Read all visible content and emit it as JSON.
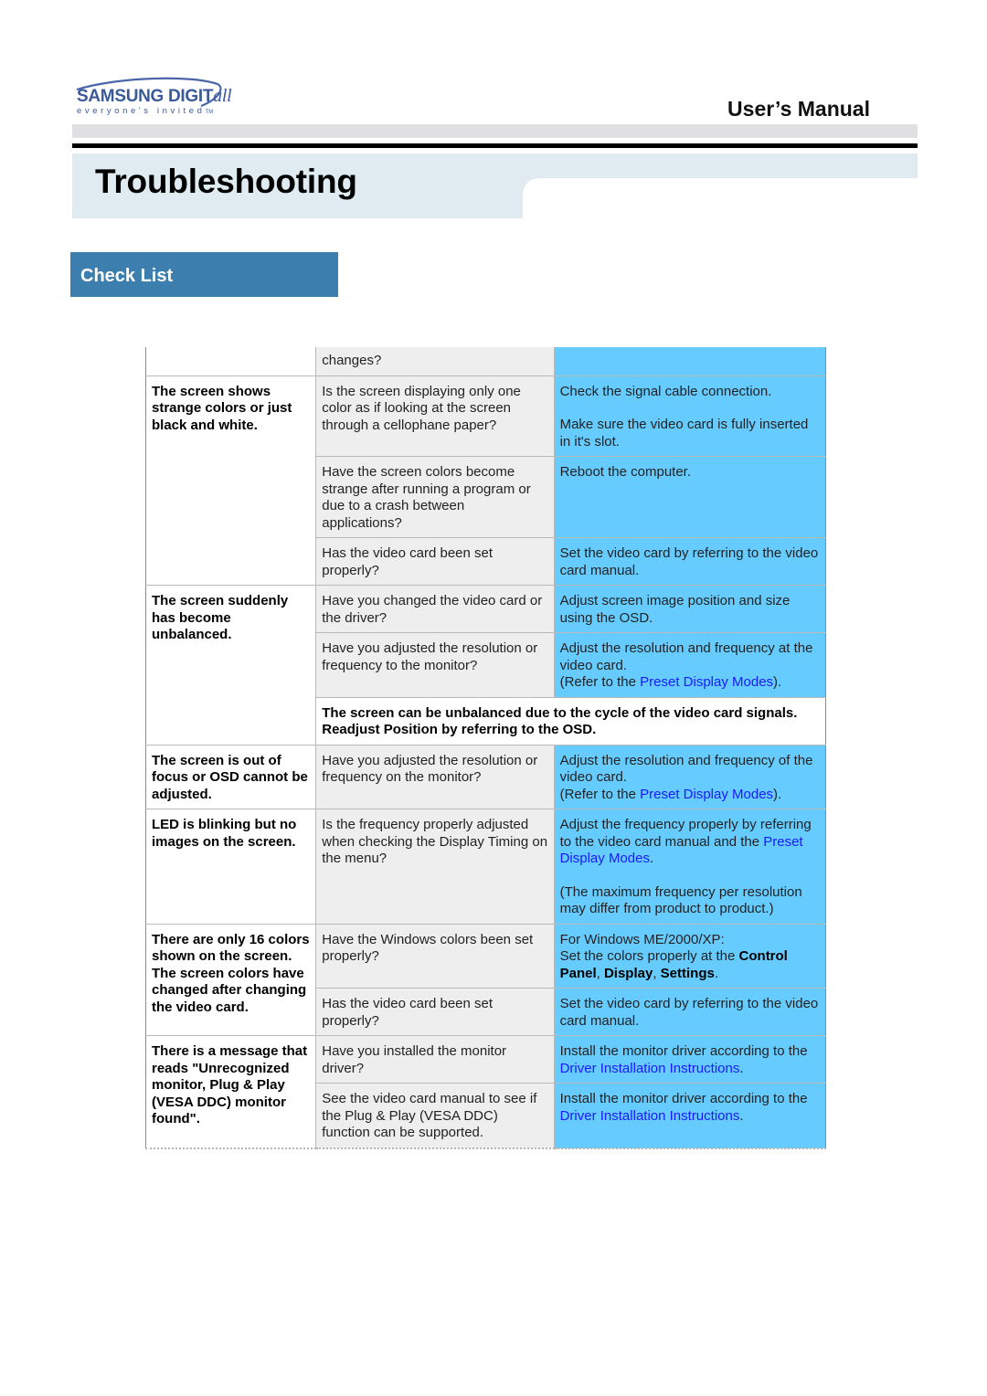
{
  "header": {
    "brand": "SAMSUNG DIGIT",
    "brand_suffix": "all",
    "tagline": "everyone's invited",
    "tagline_tm": "TM",
    "manual_title": "User’s Manual"
  },
  "page_title": "Troubleshooting",
  "section_title": "Check List",
  "colors": {
    "section_bar": "#3c7fae",
    "title_band": "#e0ebf1",
    "solution_cell": "#66ccff",
    "check_cell": "#eeeeee",
    "link": "#1a1aff"
  },
  "table": {
    "rows": [
      {
        "symptom": "",
        "check": "changes?",
        "solution": ""
      },
      {
        "symptom": "The screen shows strange colors or just black and white.",
        "check": "Is the screen displaying only one color as if looking at the screen through a cellophane paper?",
        "solution_1": "Check the signal cable connection.",
        "solution_2": "Make sure the video card is fully inserted in it's slot."
      },
      {
        "check": "Have the screen colors become strange after running a program or due to a crash between applications?",
        "solution": "Reboot the computer."
      },
      {
        "check": "Has the video card been set properly?",
        "solution": "Set the video card by referring to the video card manual."
      },
      {
        "symptom": "The screen suddenly has become unbalanced.",
        "check": "Have you changed the video card or the driver?",
        "solution": "Adjust screen image position and size using the OSD."
      },
      {
        "check": "Have you adjusted the resolution or frequency to the monitor?",
        "solution": "Adjust the resolution and frequency at the video card.",
        "refer_prefix": "(Refer to the ",
        "refer_link": "Preset Display Modes",
        "refer_suffix": ")."
      },
      {
        "note": "The screen can be unbalanced due to the cycle of the video card signals. Readjust Position by referring to the OSD."
      },
      {
        "symptom": "The screen is out of focus or OSD cannot be adjusted.",
        "check": "Have you adjusted the resolution or frequency on the monitor?",
        "solution": "Adjust the resolution and frequency of the video card.",
        "refer_prefix": "(Refer to the ",
        "refer_link": "Preset Display Modes",
        "refer_suffix": ")."
      },
      {
        "symptom": "LED is blinking but no images on the screen.",
        "check": "Is the frequency properly adjusted when checking the Display Timing on the menu?",
        "solution_prefix": "Adjust the frequency properly by referring to the video card manual and the ",
        "solution_link": "Preset Display Modes",
        "solution_suffix": ".",
        "solution_2": "(The maximum frequency per resolution may differ from product to product.)"
      },
      {
        "symptom": "There are only 16 colors shown on the screen. The screen colors have changed after changing the video card.",
        "check": "Have the Windows colors been set properly?",
        "solution_line1": "For Windows ME/2000/XP:",
        "solution_prefix": "Set the colors properly at the ",
        "bold_1": "Control Panel",
        "sep_1": ", ",
        "bold_2": "Display",
        "sep_2": ", ",
        "bold_3": "Settings",
        "solution_suffix": "."
      },
      {
        "check": "Has the video card been set properly?",
        "solution": "Set the video card by referring to the video card manual."
      },
      {
        "symptom": "There is a message that reads \"Unrecognized monitor, Plug & Play (VESA DDC) monitor found\".",
        "check": "Have you installed the monitor driver?",
        "solution_prefix": "Install the monitor driver according to the ",
        "solution_link": "Driver Installation Instructions",
        "solution_suffix": "."
      },
      {
        "check": "See the video card manual to see if the Plug & Play (VESA DDC) function can be supported.",
        "solution_prefix": "Install the monitor driver according to the ",
        "solution_link": "Driver Installation Instructions",
        "solution_suffix": "."
      }
    ]
  }
}
